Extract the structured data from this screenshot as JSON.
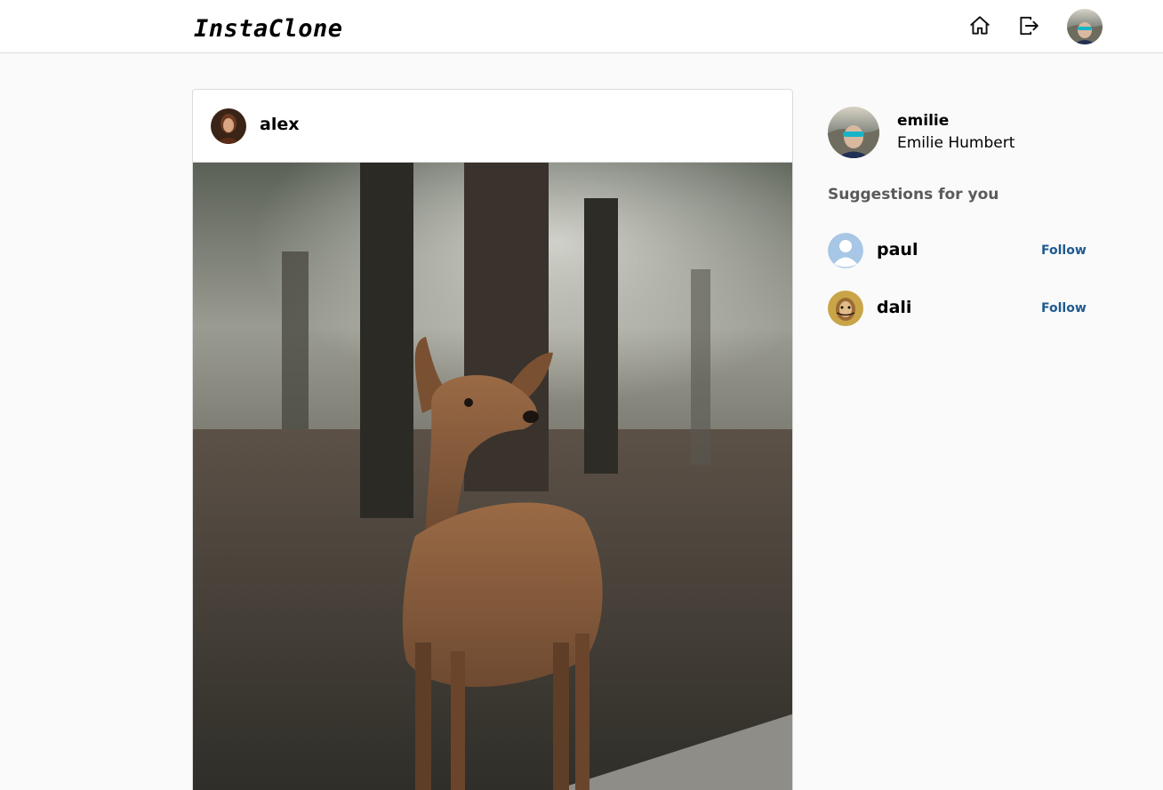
{
  "header": {
    "logo": "InstaClone",
    "icons": [
      "home-icon",
      "sign-out-icon"
    ],
    "avatar": "current-user-avatar"
  },
  "post": {
    "username": "alex",
    "avatar": "alex-avatar",
    "image": "fawn-in-forest-photo"
  },
  "sidebar": {
    "user": {
      "username": "emilie",
      "full_name": "Emilie Humbert"
    },
    "suggestions_title": "Suggestions for you",
    "suggestions": [
      {
        "username": "paul",
        "action": "Follow",
        "avatar": "default-user-avatar"
      },
      {
        "username": "dali",
        "action": "Follow",
        "avatar": "dali-avatar"
      }
    ]
  },
  "colors": {
    "background": "#fafafa",
    "border": "#dbdbdb",
    "follow": "#1f5a8f",
    "muted": "#5a5a5a"
  }
}
